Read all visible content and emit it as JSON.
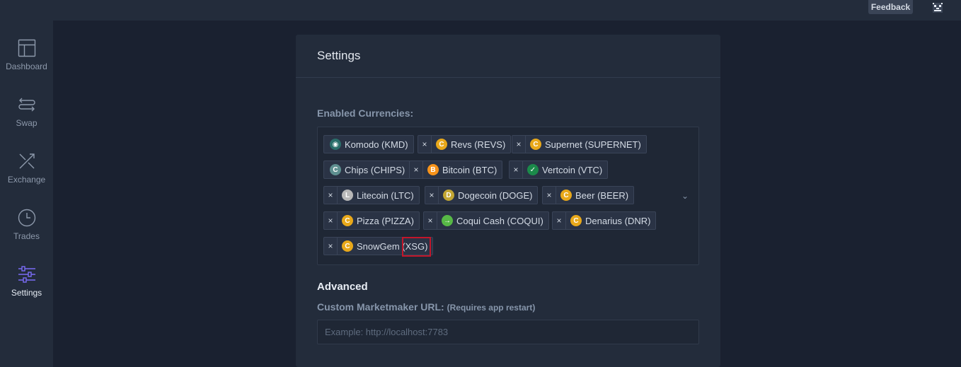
{
  "header": {
    "feedback_label": "Feedback",
    "avatar_icon": "pixel-avatar-icon"
  },
  "sidebar": {
    "items": [
      {
        "label": "Dashboard",
        "icon": "dashboard-icon",
        "active": false
      },
      {
        "label": "Swap",
        "icon": "swap-icon",
        "active": false
      },
      {
        "label": "Exchange",
        "icon": "exchange-icon",
        "active": false
      },
      {
        "label": "Trades",
        "icon": "clock-icon",
        "active": false
      },
      {
        "label": "Settings",
        "icon": "sliders-icon",
        "active": true
      }
    ],
    "active_color": "#7b6cf6"
  },
  "settings": {
    "title": "Settings",
    "enabled_currencies_label": "Enabled Currencies:",
    "currencies": [
      {
        "name": "Komodo (KMD)",
        "removable": false,
        "icon_color": "#2a6e6a"
      },
      {
        "name": "Revs (REVS)",
        "removable": true,
        "icon_color": "#e8a81a"
      },
      {
        "name": "Supernet (SUPERNET)",
        "removable": true,
        "icon_color": "#e8a81a"
      },
      {
        "name": "Chips (CHIPS)",
        "removable": false,
        "icon_color": "#5e8f90"
      },
      {
        "name": "Bitcoin (BTC)",
        "removable": true,
        "icon_color": "#f7931a"
      },
      {
        "name": "Vertcoin (VTC)",
        "removable": true,
        "icon_color": "#1b8a4a"
      },
      {
        "name": "Litecoin (LTC)",
        "removable": true,
        "icon_color": "#b8b8b8"
      },
      {
        "name": "Dogecoin (DOGE)",
        "removable": true,
        "icon_color": "#c2a633"
      },
      {
        "name": "Beer (BEER)",
        "removable": true,
        "icon_color": "#e8a81a"
      },
      {
        "name": "Pizza (PIZZA)",
        "removable": true,
        "icon_color": "#e8a81a"
      },
      {
        "name": "Coqui Cash (COQUI)",
        "removable": true,
        "icon_color": "#57b846"
      },
      {
        "name": "Denarius (DNR)",
        "removable": true,
        "icon_color": "#e8a81a"
      },
      {
        "name": "SnowGem (XSG)",
        "removable": true,
        "icon_color": "#e8a81a"
      }
    ],
    "remove_symbol": "×",
    "advanced_heading": "Advanced",
    "marketmaker_label": "Custom Marketmaker URL:",
    "marketmaker_note": "(Requires app restart)",
    "marketmaker_value": "",
    "marketmaker_placeholder": "Example: http://localhost:7783"
  },
  "highlight_color": "#c2162a"
}
